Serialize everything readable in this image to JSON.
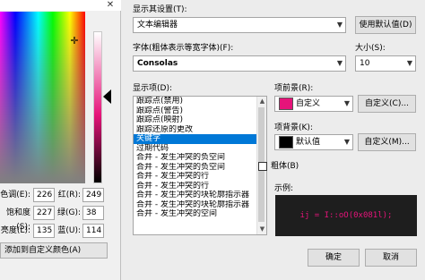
{
  "color_dialog": {
    "close_glyph": "✕",
    "crosshair_glyph": "✛",
    "fields": [
      {
        "label": "色调(E):",
        "value": "226"
      },
      {
        "label": "红(R):",
        "value": "249"
      },
      {
        "label": "饱和度(S):",
        "value": "227"
      },
      {
        "label": "绿(G):",
        "value": "38"
      },
      {
        "label": "亮度(L):",
        "value": "135"
      },
      {
        "label": "蓝(U):",
        "value": "114"
      }
    ],
    "add_button": "添加到自定义颜色(A)"
  },
  "settings": {
    "show_settings_label": "显示其设置(T):",
    "show_settings_value": "文本编辑器",
    "use_default_button": "使用默认值(D)",
    "font_label": "字体(粗体表示等宽字体)(F):",
    "font_value": "Consolas",
    "size_label": "大小(S):",
    "size_value": "10",
    "display_items_label": "显示项(D):",
    "display_items": [
      "跟踪点(禁用)",
      "跟踪点(警告)",
      "跟踪点(映射)",
      "跟踪还原的更改",
      "关键字",
      "过期代码",
      "合并 - 发生冲突的负空间",
      "合并 - 发生冲突的负空间",
      "合并 - 发生冲突的行",
      "合并 - 发生冲突的行",
      "合并 - 发生冲突的块轮廓指示器",
      "合并 - 发生冲突的块轮廓指示器",
      "合并 - 发生冲突的空间"
    ],
    "selected_index": 4,
    "foreground_label": "项前景(R):",
    "foreground_value": "自定义",
    "foreground_color": "#e6147a",
    "background_label": "项背景(K):",
    "background_value": "默认值",
    "background_color": "#000000",
    "custom_button_1": "自定义(C)...",
    "custom_button_2": "自定义(M)...",
    "bold_label": "粗体(B)",
    "sample_label": "示例:",
    "sample_text": "ij = I::oO(0x081l);",
    "ok_button": "确定",
    "cancel_button": "取消"
  }
}
